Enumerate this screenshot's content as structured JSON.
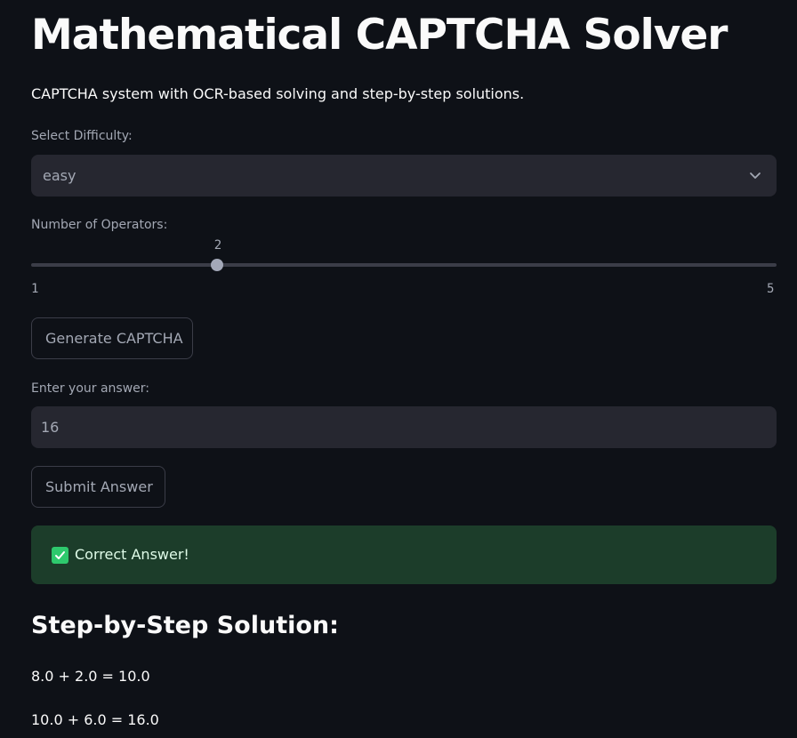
{
  "page": {
    "title": "Mathematical CAPTCHA Solver",
    "subtitle": "CAPTCHA system with OCR-based solving and step-by-step solutions."
  },
  "difficulty": {
    "label": "Select Difficulty:",
    "selected": "easy",
    "icon": "chevron-down-icon"
  },
  "operators": {
    "label": "Number of Operators:",
    "value": "2",
    "min": "1",
    "max": "5"
  },
  "generate": {
    "label": "Generate CAPTCHA"
  },
  "answer": {
    "label": "Enter your answer:",
    "value": "16"
  },
  "submit": {
    "label": "Submit Answer"
  },
  "result": {
    "message": "Correct Answer!",
    "icon": "check-icon",
    "color": "#1c3d2a"
  },
  "solution": {
    "heading": "Step-by-Step Solution:",
    "steps": [
      "8.0 + 2.0 = 10.0",
      "10.0 + 6.0 = 16.0"
    ]
  }
}
